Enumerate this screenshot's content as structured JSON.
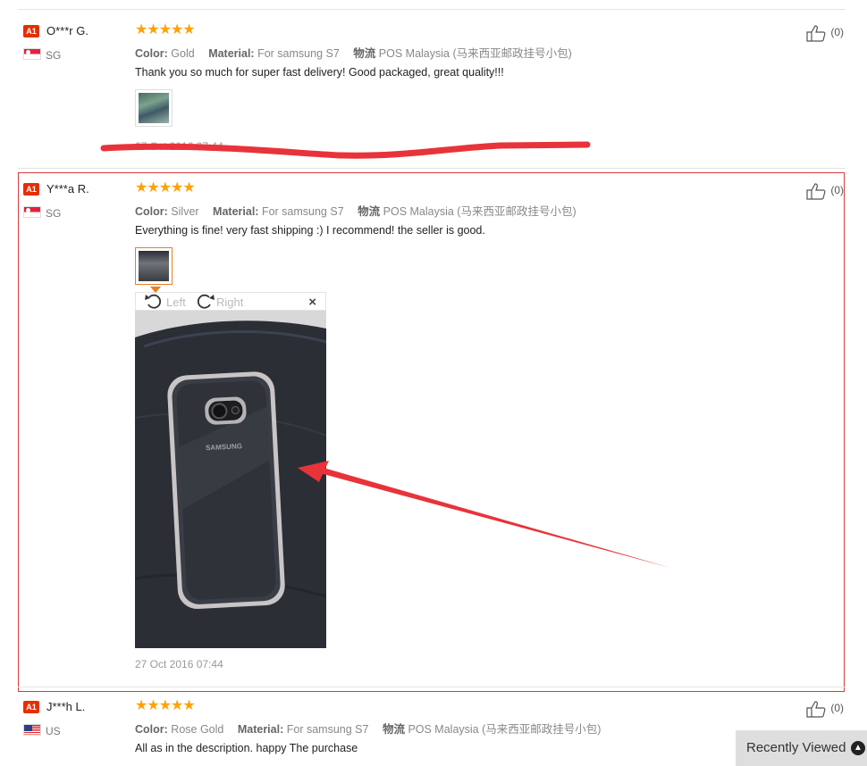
{
  "reviews": [
    {
      "level": "A1",
      "user": "O***r G.",
      "country": "SG",
      "stars": "★★★★★",
      "color_label": "Color:",
      "color_value": "Gold",
      "material_label": "Material:",
      "material_value": "For samsung S7",
      "shipping_label": "物流",
      "shipping_value": "POS Malaysia (马来西亚邮政挂号小包)",
      "text": "Thank you so much for super fast delivery! Good packaged, great quality!!!",
      "date": "27 Oct 2016 07:44",
      "helpful": "(0)"
    },
    {
      "level": "A1",
      "user": "Y***a R.",
      "country": "SG",
      "stars": "★★★★★",
      "color_label": "Color:",
      "color_value": "Silver",
      "material_label": "Material:",
      "material_value": "For samsung S7",
      "shipping_label": "物流",
      "shipping_value": "POS Malaysia (马来西亚邮政挂号小包)",
      "text": "Everything is fine! very fast shipping :) I recommend! the seller is good.",
      "date": "27 Oct 2016 07:44",
      "helpful": "(0)"
    },
    {
      "level": "A1",
      "user": "J***h L.",
      "country": "US",
      "stars": "★★★★★",
      "color_label": "Color:",
      "color_value": "Rose Gold",
      "material_label": "Material:",
      "material_value": "For samsung S7",
      "shipping_label": "物流",
      "shipping_value": "POS Malaysia (马来西亚邮政挂号小包)",
      "text": "All as in the description. happy The purchase",
      "helpful": "(0)"
    }
  ],
  "viewer": {
    "rotate_left": "Left",
    "rotate_right": "Right",
    "close": "×",
    "phone_brand": "SAMSUNG"
  },
  "recently_viewed": "Recently Viewed",
  "annotation_colors": {
    "red": "#e8333a"
  }
}
